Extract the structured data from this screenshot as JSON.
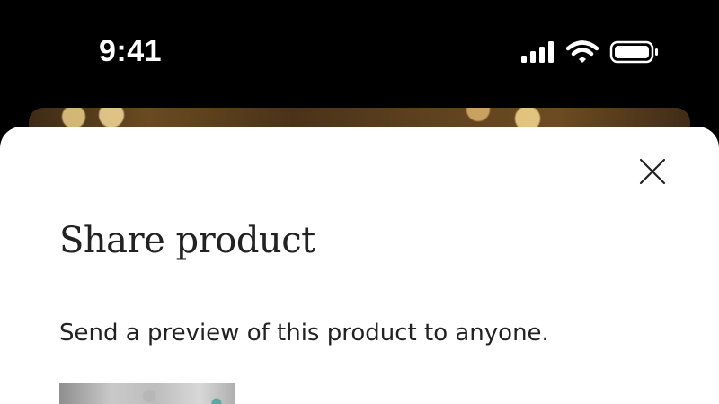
{
  "status_bar": {
    "time": "9:41",
    "icons": [
      "cellular-signal-icon",
      "wifi-icon",
      "battery-icon"
    ]
  },
  "sheet": {
    "title": "Share product",
    "subtitle": "Send a preview of this product to anyone.",
    "close_icon": "close-icon"
  },
  "colors": {
    "status_bar_bg": "#000000",
    "sheet_bg": "#ffffff",
    "text": "#222222"
  }
}
